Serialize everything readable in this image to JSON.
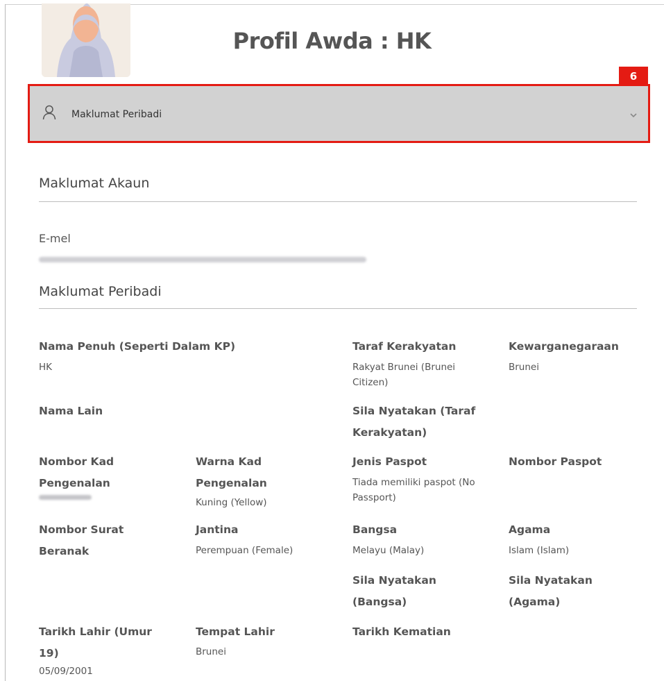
{
  "page": {
    "title": "Profil Awda : HK"
  },
  "callout": {
    "number": "6",
    "color": "#e41b13"
  },
  "accordion": {
    "icon": "user-icon",
    "label": "Maklumat Peribadi",
    "chevron": "chevron-down-icon"
  },
  "account_section": {
    "title": "Maklumat Akaun",
    "email_label": "E-mel"
  },
  "personal_section": {
    "title": "Maklumat Peribadi",
    "fields": {
      "nama_penuh": {
        "label": "Nama Penuh (Seperti Dalam KP)",
        "value": "HK"
      },
      "taraf_kerakyatan": {
        "label": "Taraf Kerakyatan",
        "value": "Rakyat Brunei (Brunei Citizen)"
      },
      "kewarganegaraan": {
        "label": "Kewarganegaraan",
        "value": "Brunei"
      },
      "nama_lain": {
        "label": "Nama Lain"
      },
      "sila_taraf": {
        "label": "Sila Nyatakan (Taraf Kerakyatan)"
      },
      "nombor_kad": {
        "label": "Nombor Kad Pengenalan"
      },
      "warna_kad": {
        "label": "Warna Kad Pengenalan",
        "value": "Kuning (Yellow)"
      },
      "jenis_paspot": {
        "label": "Jenis Paspot",
        "value": "Tiada memiliki paspot (No Passport)"
      },
      "nombor_paspot": {
        "label": "Nombor Paspot"
      },
      "nombor_surat": {
        "label": "Nombor Surat Beranak"
      },
      "jantina": {
        "label": "Jantina",
        "value": "Perempuan (Female)"
      },
      "bangsa": {
        "label": "Bangsa",
        "value": "Melayu (Malay)"
      },
      "agama": {
        "label": "Agama",
        "value": "Islam (Islam)"
      },
      "sila_bangsa": {
        "label": "Sila Nyatakan (Bangsa)"
      },
      "sila_agama": {
        "label": "Sila Nyatakan (Agama)"
      },
      "tarikh_lahir": {
        "label": "Tarikh Lahir (Umur 19)",
        "value": "05/09/2001"
      },
      "tempat_lahir": {
        "label": "Tempat Lahir",
        "value": "Brunei"
      },
      "tarikh_kematian": {
        "label": "Tarikh Kematian"
      }
    }
  }
}
